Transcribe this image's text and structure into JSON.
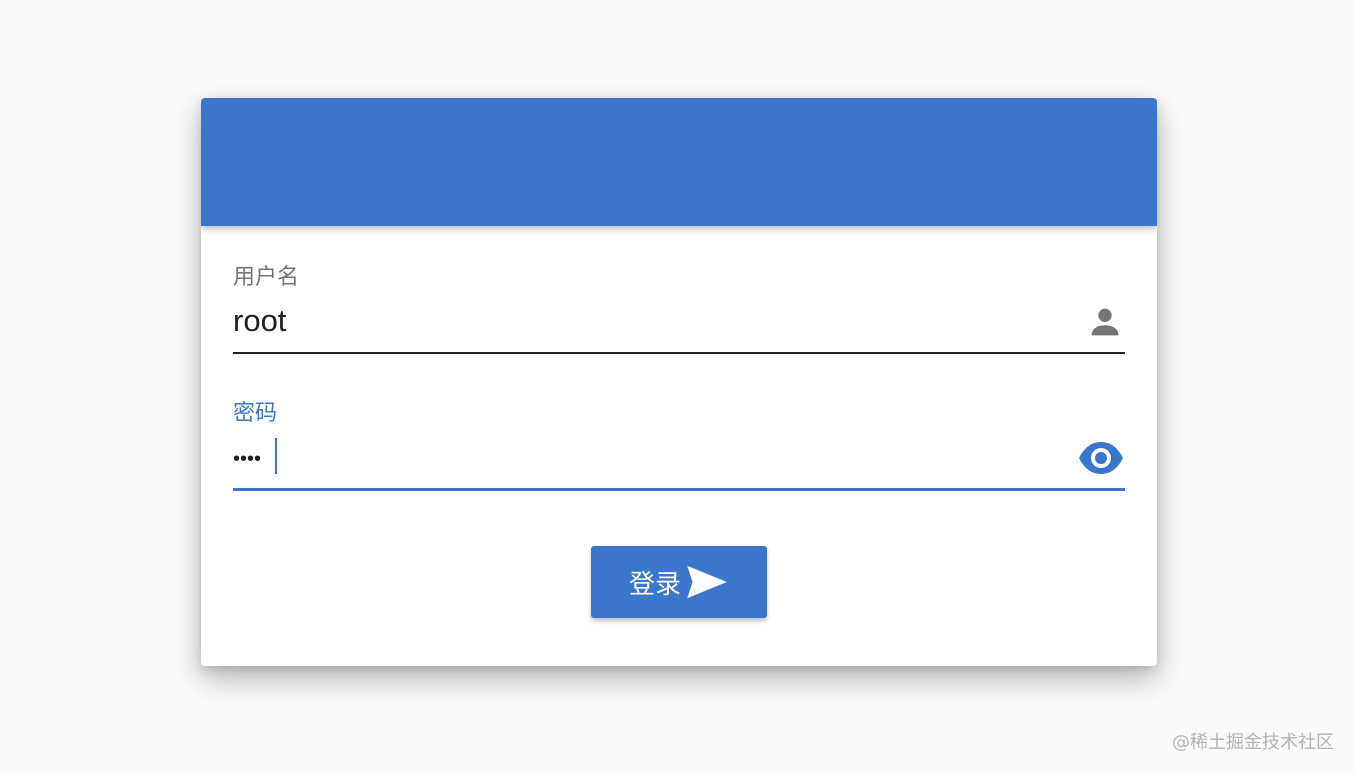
{
  "login_form": {
    "username": {
      "label": "用户名",
      "value": "root",
      "icon": "person-icon"
    },
    "password": {
      "label": "密码",
      "masked_value": "••••",
      "icon": "eye-icon"
    },
    "submit": {
      "label": "登录",
      "icon": "send-icon"
    }
  },
  "watermark": "@稀土掘金技术社区",
  "colors": {
    "primary": "#3a76cb",
    "background": "#fafafa",
    "card": "#ffffff",
    "label_gray": "#757575",
    "text": "#212121"
  }
}
